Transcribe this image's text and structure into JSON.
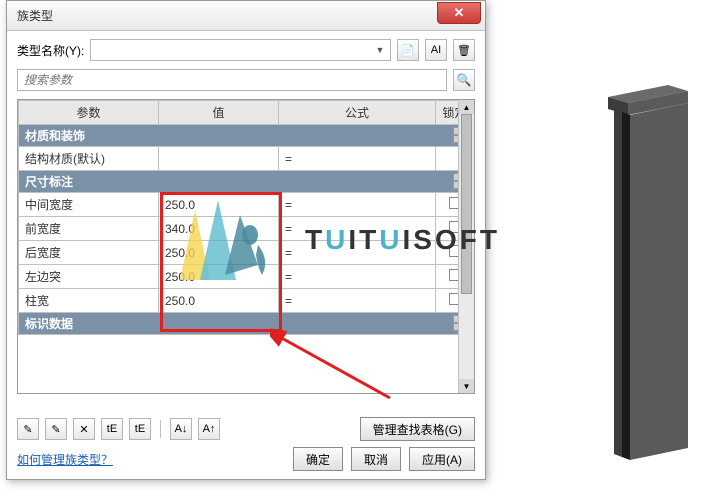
{
  "dialog": {
    "title": "族类型",
    "typeNameLabel": "类型名称(Y):",
    "typeNameValue": "",
    "searchPlaceholder": "搜索参数",
    "iconNew": "✎",
    "iconDup": "✎",
    "iconRename": "AI"
  },
  "columns": {
    "param": "参数",
    "value": "值",
    "formula": "公式",
    "lock": "锁定"
  },
  "groups": [
    {
      "name": "材质和装饰",
      "rows": [
        {
          "param": "结构材质(默认)",
          "value": "",
          "formula": "=",
          "hasLock": false
        }
      ]
    },
    {
      "name": "尺寸标注",
      "rows": [
        {
          "param": "中间宽度",
          "value": "250.0",
          "formula": "=",
          "hasLock": true
        },
        {
          "param": "前宽度",
          "value": "340.0",
          "formula": "=",
          "hasLock": true
        },
        {
          "param": "后宽度",
          "value": "250.0",
          "formula": "=",
          "hasLock": true
        },
        {
          "param": "左边突",
          "value": "250.0",
          "formula": "=",
          "hasLock": true
        },
        {
          "param": "柱宽",
          "value": "250.0",
          "formula": "=",
          "hasLock": true
        }
      ]
    },
    {
      "name": "标识数据",
      "rows": []
    }
  ],
  "footer": {
    "toolbarIcons": [
      "✎",
      "✎",
      "✕",
      "↕",
      "↕",
      " ",
      "Â↓",
      "A↑"
    ],
    "manageLookup": "管理查找表格(G)",
    "helpLink": "如何管理族类型？",
    "ok": "确定",
    "cancel": "取消",
    "apply": "应用(A)"
  },
  "watermark": {
    "text": "TUITUISOFT"
  }
}
